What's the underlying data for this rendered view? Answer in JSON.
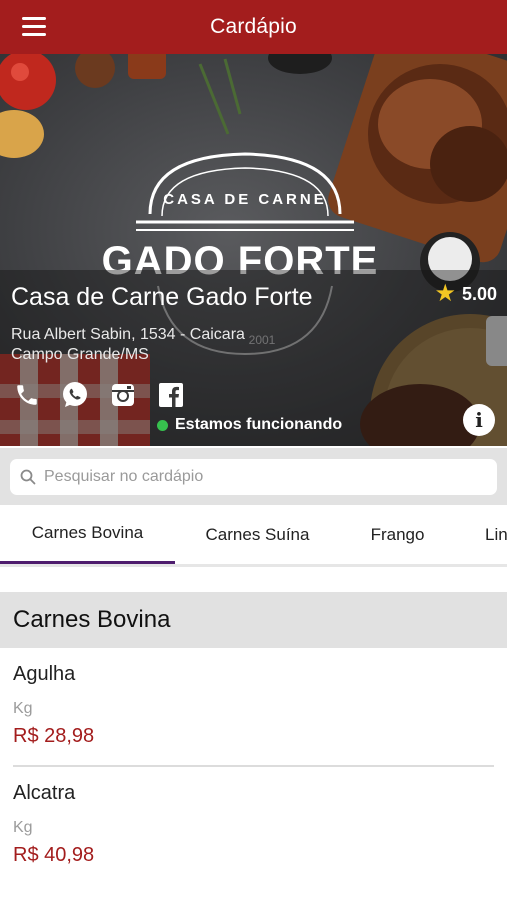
{
  "appbar": {
    "title": "Cardápio"
  },
  "restaurant": {
    "name": "Casa de Carne Gado Forte",
    "rating": "5.00",
    "address_line1": "Rua Albert Sabin, 1534 - Caicara",
    "address_line2": "Campo Grande/MS",
    "status": "Estamos funcionando",
    "logo_arc_text": "CASA DE CARNE",
    "logo_main_text": "GADO FORTE",
    "logo_small_text": "2001"
  },
  "social": [
    "phone-icon",
    "whatsapp-icon",
    "instagram-icon",
    "facebook-icon"
  ],
  "search": {
    "placeholder": "Pesquisar no cardápio"
  },
  "tabs": [
    {
      "label": "Carnes Bovina",
      "active": true
    },
    {
      "label": "Carnes Suína",
      "active": false
    },
    {
      "label": "Frango",
      "active": false
    },
    {
      "label": "Lin",
      "active": false
    }
  ],
  "section": {
    "title": "Carnes Bovina"
  },
  "items": [
    {
      "name": "Agulha",
      "unit": "Kg",
      "price": "R$ 28,98"
    },
    {
      "name": "Alcatra",
      "unit": "Kg",
      "price": "R$ 40,98"
    }
  ],
  "colors": {
    "brand": "#a31d1d",
    "tab_indicator": "#4e1d6e",
    "status_online": "#37c04e",
    "rating_star": "#f3c623"
  }
}
